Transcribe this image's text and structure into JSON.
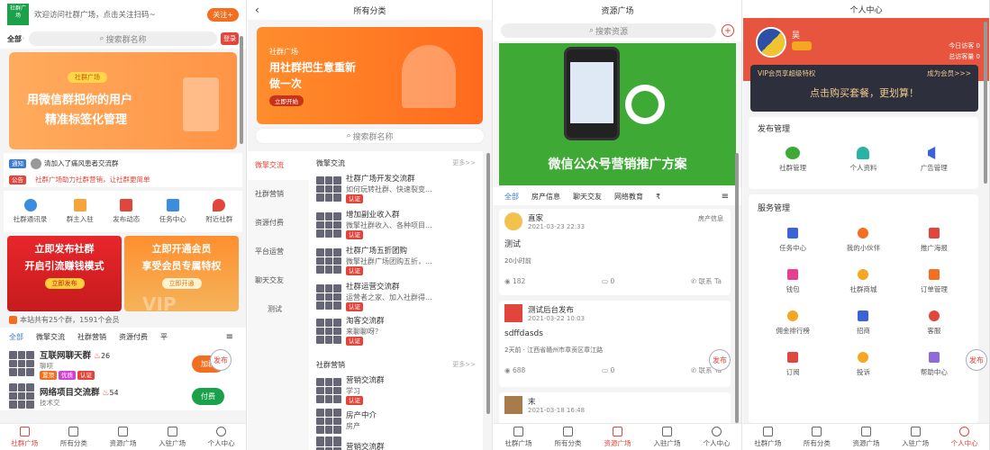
{
  "p1": {
    "header_text": "欢迎访问社群广场，点击关注扫码~",
    "follow_btn": "关注+",
    "logo": "社群广场",
    "region": "全部",
    "search_placeholder": "搜索群名称",
    "login_btn": "登录",
    "banner": {
      "tag": "社群广场",
      "line1": "用微信群把你的用户",
      "line2": "精准标签化管理"
    },
    "notice_label": "通知",
    "notice_text": "清加入了痛风患者交流群",
    "ann_label": "公告",
    "ann_text": "社群广场助力社群营销，让社群更简单",
    "icons": [
      "社群通讯录",
      "群主入驻",
      "发布动态",
      "任务中心",
      "附近社群"
    ],
    "promo_left": {
      "l1": "立即发布社群",
      "l2": "开启引流赚钱模式",
      "btn": "立即发布"
    },
    "promo_right": {
      "l1": "立即开通会员",
      "l2": "享受会员专属特权",
      "btn": "立即开通",
      "vip": "VIP"
    },
    "stats": "本站共有25个群，1591个会员",
    "tabs": [
      "全部",
      "微擎交流",
      "社群营销",
      "资源付费",
      "平"
    ],
    "items": [
      {
        "title": "互联网聊天群",
        "count": "26",
        "sub": "聊呗",
        "badges": [
          "置顶",
          "优质",
          "认证"
        ],
        "btn": "加群"
      },
      {
        "title": "网络项目交流群",
        "count": "54",
        "sub": "技术交",
        "badges": [],
        "btn": "付费"
      }
    ],
    "publish": "发布",
    "tabbar": [
      "社群广场",
      "所有分类",
      "资源广场",
      "入驻广场",
      "个人中心"
    ]
  },
  "p2": {
    "title": "所有分类",
    "banner": {
      "tag": "社群广场",
      "l1": "用社群把生意重新",
      "l2": "做一次",
      "btn": "立即开始"
    },
    "search_placeholder": "搜索群名称",
    "side": [
      "微擎交流",
      "社群营销",
      "资源付费",
      "平台运营",
      "聊天交友",
      "测试"
    ],
    "sec1": {
      "title": "微擎交流",
      "more": "更多>>"
    },
    "sec1_items": [
      {
        "title": "社群广场开发交流群",
        "sub": "如何玩转社群、快速裂变...",
        "badge": "认证"
      },
      {
        "title": "增加副业收入群",
        "sub": "微擎社群收入、各种项目...",
        "badge": "认证"
      },
      {
        "title": "社群广场五折团购",
        "sub": "微擎社群广场团购五折，...",
        "badge": "认证"
      },
      {
        "title": "社群运营交流群",
        "sub": "运营者之家、加入社群得...",
        "badge": "认证"
      },
      {
        "title": "淘客交流群",
        "sub": "来聊聊呀？",
        "badge": "认证"
      }
    ],
    "sec2": {
      "title": "社群营销",
      "more": "更多>>"
    },
    "sec2_items": [
      {
        "title": "营销交流群",
        "sub": "学习",
        "badge": "认证"
      },
      {
        "title": "房产中介",
        "sub": "房产",
        "badge": ""
      },
      {
        "title": "营销交流群",
        "sub": "",
        "badge": ""
      }
    ]
  },
  "p3": {
    "title": "资源广场",
    "search_placeholder": "搜索资源",
    "banner_text": "微信公众号营销推广方案",
    "tabs": [
      "全部",
      "房产信息",
      "聊天交友",
      "网络教育",
      "₹"
    ],
    "posts": [
      {
        "name": "直家",
        "time": "2021-03-23 22:33",
        "tag": "房产信息",
        "content": "测试",
        "meta": "20小时前",
        "views": "182",
        "comments": "0",
        "contact": "联系 Ta"
      },
      {
        "name": "测试后台发布",
        "time": "2021-03-22 10:03",
        "tag": "",
        "content": "sdffdasds",
        "meta": "2天前 · 江西省赣州市章贡区章江路",
        "views": "688",
        "comments": "0",
        "contact": "联系 Ta"
      },
      {
        "name": "末",
        "time": "2021-03-18 16:48",
        "tag": "",
        "content": "",
        "meta": "",
        "views": "",
        "comments": "",
        "contact": ""
      }
    ],
    "tabbar": [
      "社群广场",
      "所有分类",
      "资源广场",
      "入驻广场",
      "个人中心"
    ]
  },
  "p4": {
    "title": "个人中心",
    "username": "吴",
    "today_visits": "今日访客 0",
    "total_visits": "总访客量 0",
    "vip_left": "VIP会员享超级特权",
    "vip_right": "成为会员>>>",
    "vip_main": "点击购买套餐，更划算！",
    "pub_title": "发布管理",
    "pub_items": [
      "社群管理",
      "个人资料",
      "广告管理"
    ],
    "svc_title": "服务管理",
    "svc_items": [
      "任务中心",
      "我的小伙伴",
      "推广海报",
      "钱包",
      "社群商城",
      "订单管理",
      "佣金排行榜",
      "招商",
      "客服",
      "订阅",
      "投诉",
      "帮助中心"
    ],
    "publish": "发布",
    "tabbar": [
      "社群广场",
      "所有分类",
      "资源广场",
      "入驻广场",
      "个人中心"
    ]
  }
}
